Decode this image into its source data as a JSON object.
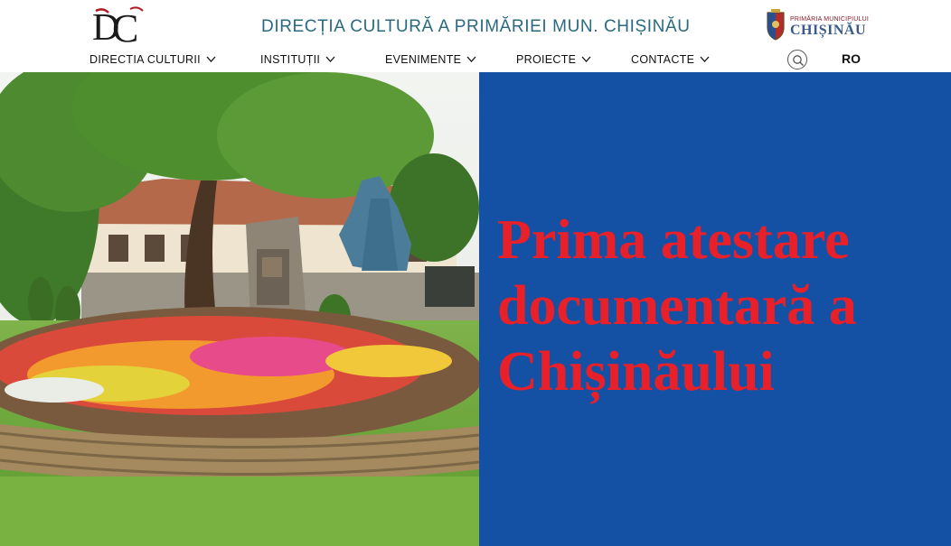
{
  "header": {
    "logo_text": "DC",
    "site_title": "DIRECȚIA CULTURĂ A PRIMĂRIEI MUN. CHIȘINĂU",
    "city_logo": {
      "small_text": "PRIMĂRIA MUNICIPIULUI",
      "big_text": "CHIȘINĂU"
    },
    "language": "RO"
  },
  "nav": {
    "items": [
      {
        "label": "DIRECTIA CULTURII"
      },
      {
        "label": "INSTITUȚII"
      },
      {
        "label": "EVENIMENTE"
      },
      {
        "label": "PROIECTE"
      },
      {
        "label": "CONTACTE"
      }
    ]
  },
  "hero": {
    "title": "Prima atestare documentară a Chișinăului"
  },
  "colors": {
    "title_teal": "#2a6a80",
    "panel_blue": "#1450a4",
    "hero_red": "#e8202a"
  },
  "icons": {
    "search": "search-icon",
    "chevron": "chevron-down-icon"
  }
}
